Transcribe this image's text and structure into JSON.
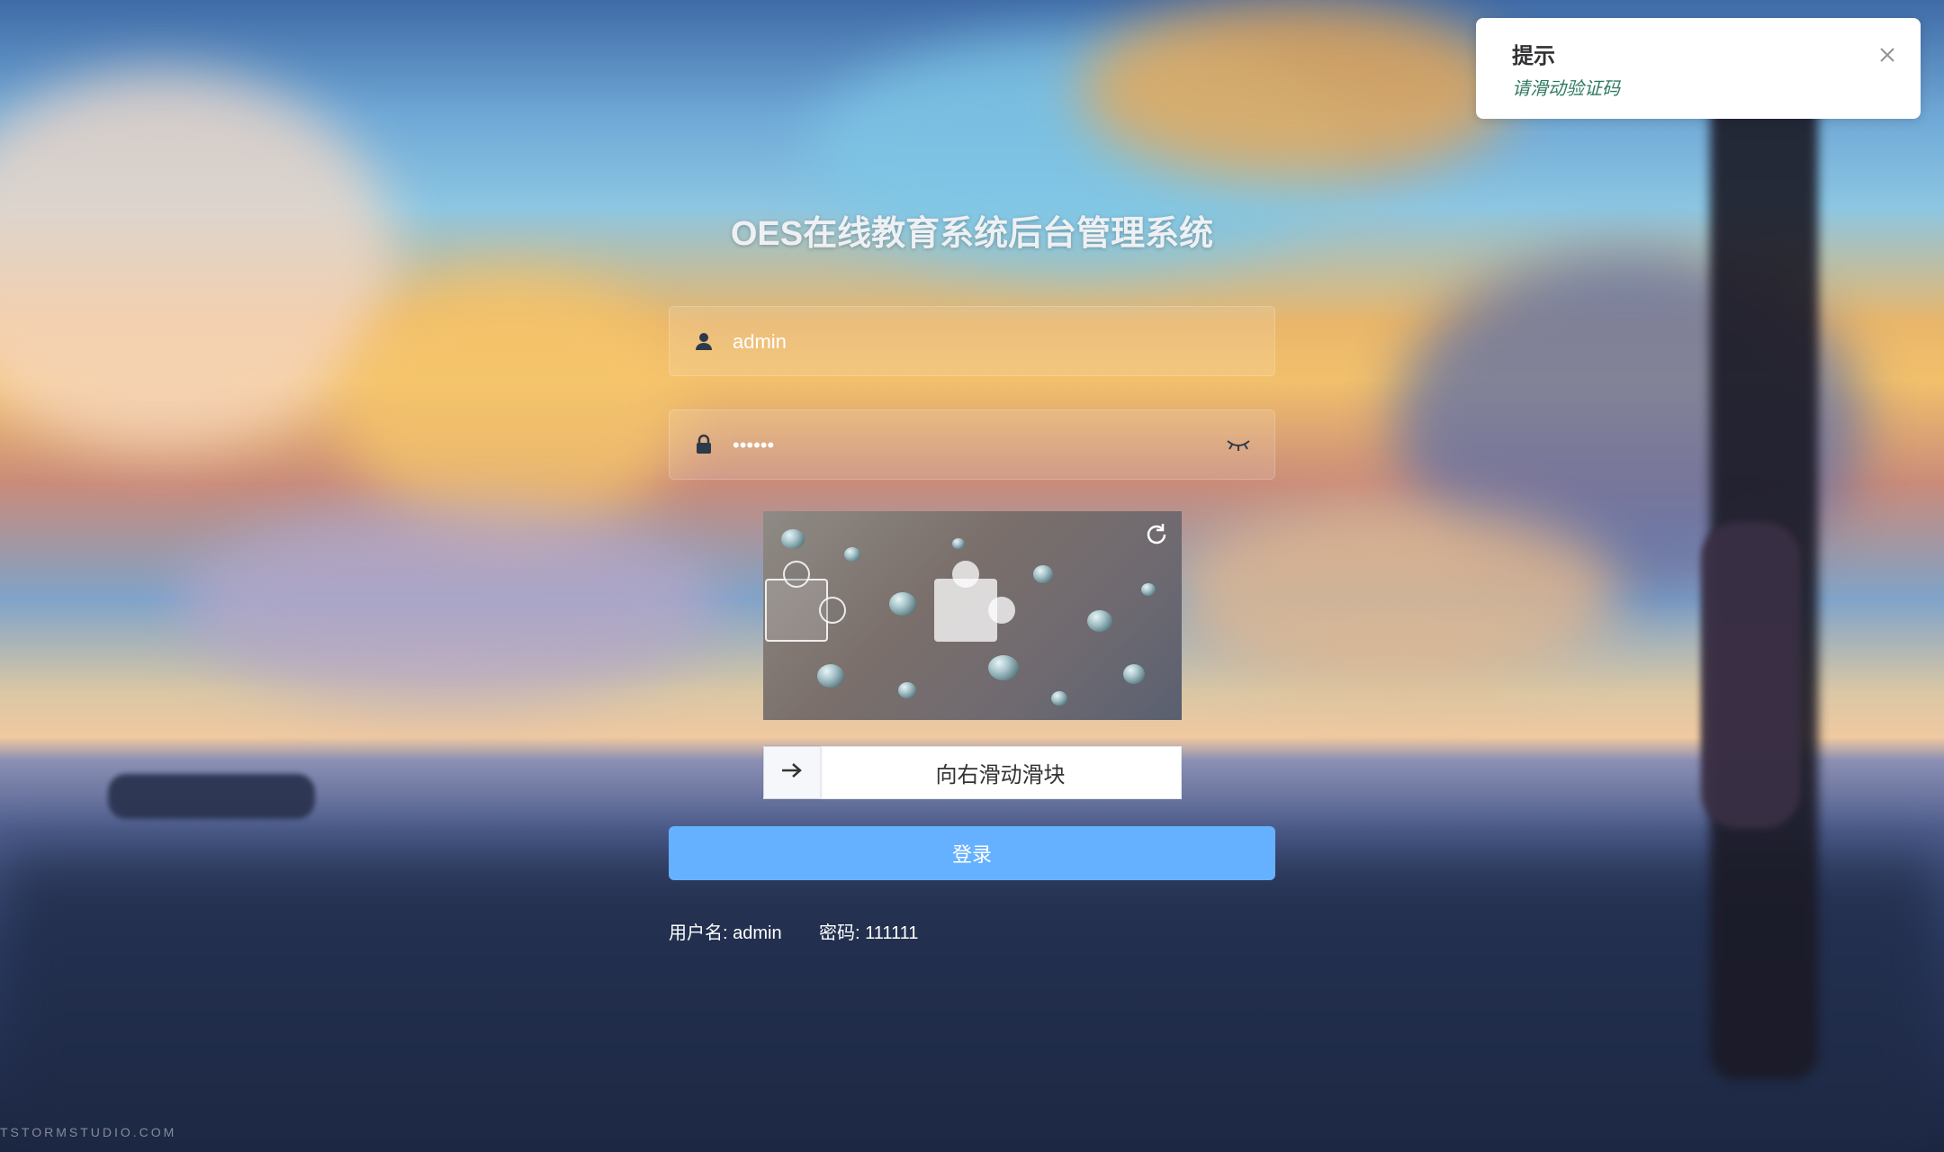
{
  "page": {
    "title": "OES在线教育系统后台管理系统",
    "watermark": "TSTORMSTUDIO.COM"
  },
  "form": {
    "username": {
      "value": "admin",
      "icon": "user-icon"
    },
    "password": {
      "value": "111111",
      "icon": "lock-icon",
      "toggle_icon": "eye-closed-icon"
    }
  },
  "captcha": {
    "refresh_icon": "refresh-icon",
    "slider_text": "向右滑动滑块",
    "handle_icon": "arrow-right-icon"
  },
  "login_button": {
    "label": "登录"
  },
  "hints": {
    "username": "用户名: admin",
    "password": "密码: 111111"
  },
  "notification": {
    "title": "提示",
    "message": "请滑动验证码",
    "close_icon": "close-icon"
  },
  "colors": {
    "primary_button": "#66b1ff",
    "notify_message": "#2f7a5f"
  }
}
